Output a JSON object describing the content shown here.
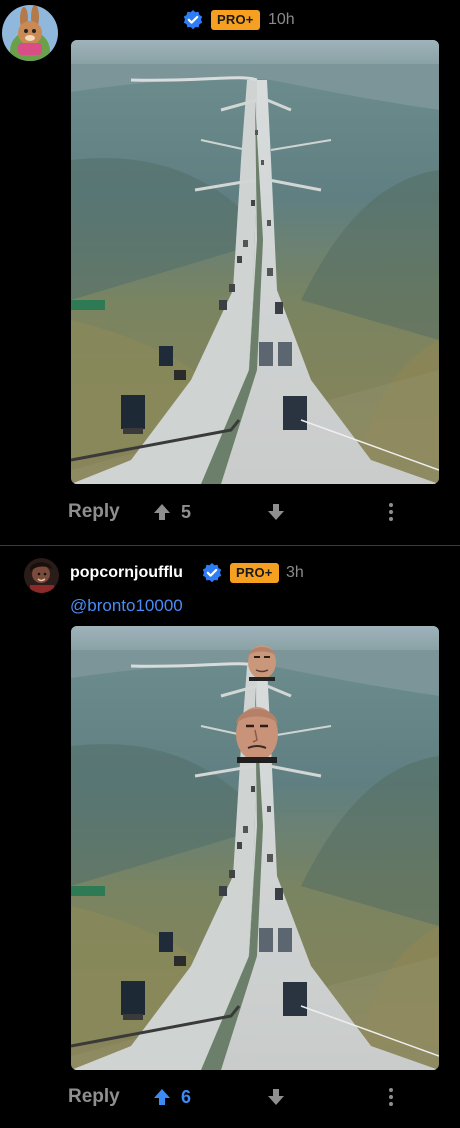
{
  "comments": [
    {
      "username": "",
      "badge": "PRO+",
      "timestamp": "10h",
      "mention": "",
      "reply_label": "Reply",
      "upvotes": "5",
      "upvote_active": false
    },
    {
      "username": "popcornjoufflu",
      "badge": "PRO+",
      "timestamp": "3h",
      "mention": "@bronto10000",
      "reply_label": "Reply",
      "upvotes": "6",
      "upvote_active": true
    }
  ],
  "colors": {
    "background": "#000000",
    "pro_badge": "#f5a020",
    "verified": "#2f7df6",
    "mention": "#4a8cf7",
    "upvote_active": "#3d8bf2",
    "muted": "#8f8f8f"
  },
  "icons": {
    "verified": "verified-check-icon",
    "upvote": "arrow-up-icon",
    "downvote": "arrow-down-icon",
    "more": "more-vertical-icon"
  }
}
